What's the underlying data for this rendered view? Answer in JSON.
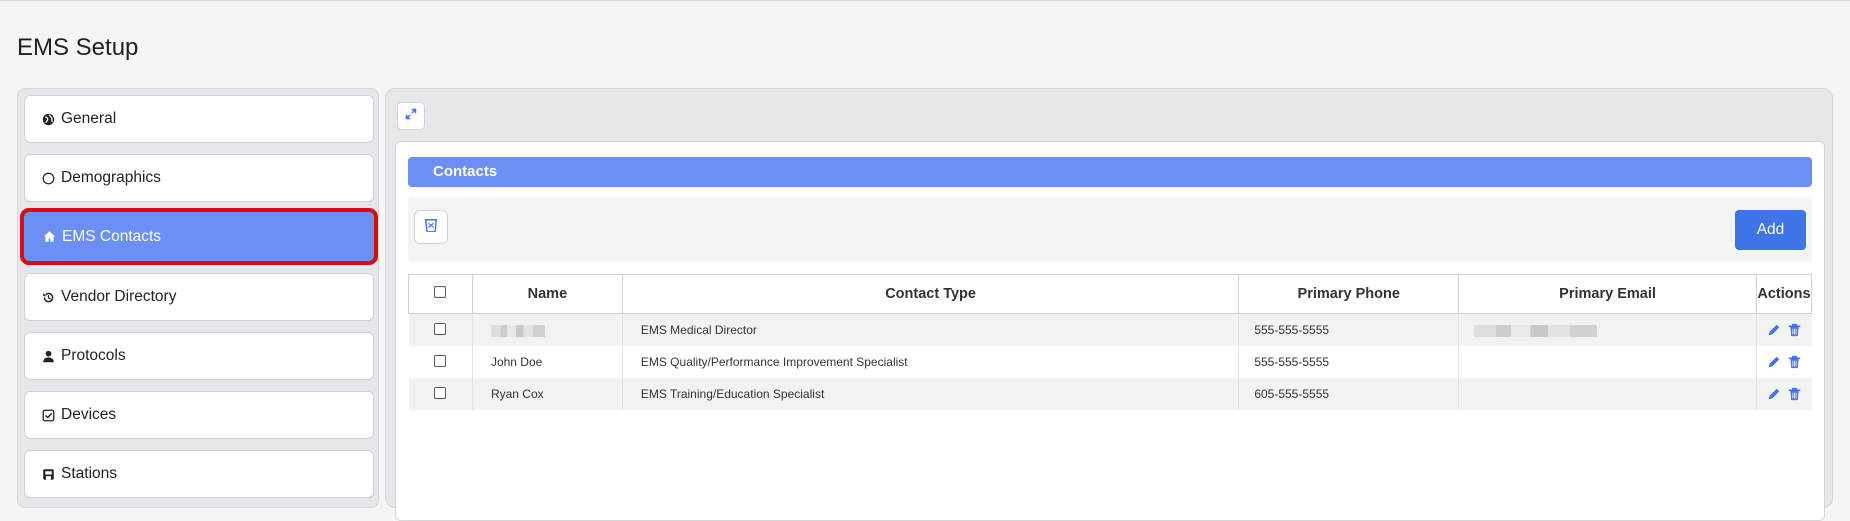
{
  "page": {
    "title": "EMS Setup"
  },
  "sidebar": {
    "items": [
      {
        "label": "General",
        "icon": "globe-icon",
        "active": false
      },
      {
        "label": "Demographics",
        "icon": "circle-icon",
        "active": false
      },
      {
        "label": "EMS Contacts",
        "icon": "home-icon",
        "active": true
      },
      {
        "label": "Vendor Directory",
        "icon": "history-icon",
        "active": false
      },
      {
        "label": "Protocols",
        "icon": "user-icon",
        "active": false
      },
      {
        "label": "Devices",
        "icon": "check-square-icon",
        "active": false
      },
      {
        "label": "Stations",
        "icon": "building-icon",
        "active": false
      }
    ]
  },
  "contacts": {
    "header": "Contacts",
    "add_label": "Add",
    "columns": [
      "Name",
      "Contact Type",
      "Primary Phone",
      "Primary Email",
      "Actions"
    ],
    "rows": [
      {
        "name": "",
        "type": "EMS Medical Director",
        "phone": "555-555-5555",
        "email": ""
      },
      {
        "name": "John Doe",
        "type": "EMS Quality/Performance Improvement Specialist",
        "phone": "555-555-5555",
        "email": ""
      },
      {
        "name": "Ryan Cox",
        "type": "EMS Training/Education Specialist",
        "phone": "605-555-5555",
        "email": ""
      }
    ]
  },
  "colors": {
    "accent": "#6b8ff4",
    "button": "#3f73e8",
    "active_outline": "#d50f0f",
    "action_icon": "#3f73e8"
  }
}
